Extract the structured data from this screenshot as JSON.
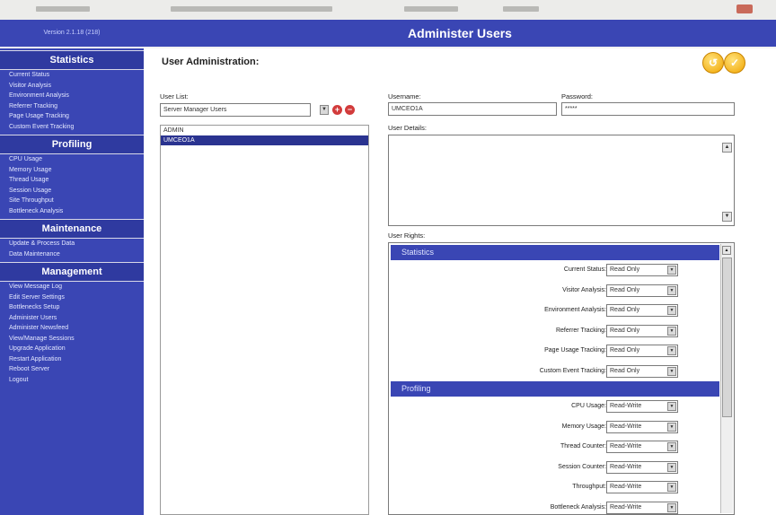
{
  "window": {
    "title": "Administer Users"
  },
  "sidebar": {
    "version": "Version 2.1.18 (218)",
    "sections": [
      {
        "title": "Statistics",
        "items": [
          "Current Status",
          "Visitor Analysis",
          "Environment Analysis",
          "Referrer Tracking",
          "Page Usage Tracking",
          "Custom Event Tracking"
        ]
      },
      {
        "title": "Profiling",
        "items": [
          "CPU Usage",
          "Memory Usage",
          "Thread Usage",
          "Session Usage",
          "Site Throughput",
          "Bottleneck Analysis"
        ]
      },
      {
        "title": "Maintenance",
        "items": [
          "Update & Process Data",
          "Data Maintenance"
        ]
      },
      {
        "title": "Management",
        "items": [
          "View Message Log",
          "Edit Server Settings",
          "Bottlenecks Setup",
          "Administer Users",
          "Administer Newsfeed",
          "View/Manage Sessions",
          "Upgrade Application",
          "Restart Application",
          "Reboot Server",
          "Logout"
        ]
      }
    ]
  },
  "main": {
    "page_title": "User Administration:",
    "user_list_label": "User List:",
    "user_list_filter": "Server Manager Users",
    "users": [
      "ADMIN",
      "UMCEO1A"
    ],
    "selected_user_index": 1,
    "username_label": "Username:",
    "username_value": "UMCEO1A",
    "password_label": "Password:",
    "password_value": "*****",
    "details_label": "User Details:",
    "rights_label": "User Rights:"
  },
  "rights": [
    {
      "group": "Statistics",
      "rows": [
        {
          "label": "Current Status:",
          "value": "Read Only"
        },
        {
          "label": "Visitor Analysis:",
          "value": "Read Only"
        },
        {
          "label": "Environment Analysis:",
          "value": "Read Only"
        },
        {
          "label": "Referrer Tracking:",
          "value": "Read Only"
        },
        {
          "label": "Page Usage Tracking:",
          "value": "Read Only"
        },
        {
          "label": "Custom Event Tracking:",
          "value": "Read Only"
        }
      ]
    },
    {
      "group": "Profiling",
      "rows": [
        {
          "label": "CPU Usage:",
          "value": "Read-Write"
        },
        {
          "label": "Memory Usage:",
          "value": "Read-Write"
        },
        {
          "label": "Thread Counter:",
          "value": "Read-Write"
        },
        {
          "label": "Session Counter:",
          "value": "Read-Write"
        },
        {
          "label": "Throughput:",
          "value": "Read-Write"
        },
        {
          "label": "Bottleneck Analysis:",
          "value": "Read-Write"
        }
      ]
    }
  ],
  "icons": {
    "undo": "undo-icon",
    "save": "save-icon",
    "add_user": "add-icon",
    "delete_user": "delete-icon"
  },
  "colors": {
    "sidebar": "#3a46b4",
    "header": "#3a46b4",
    "selection": "#2a3390",
    "action": "#f0a400",
    "danger": "#d23b3b"
  }
}
